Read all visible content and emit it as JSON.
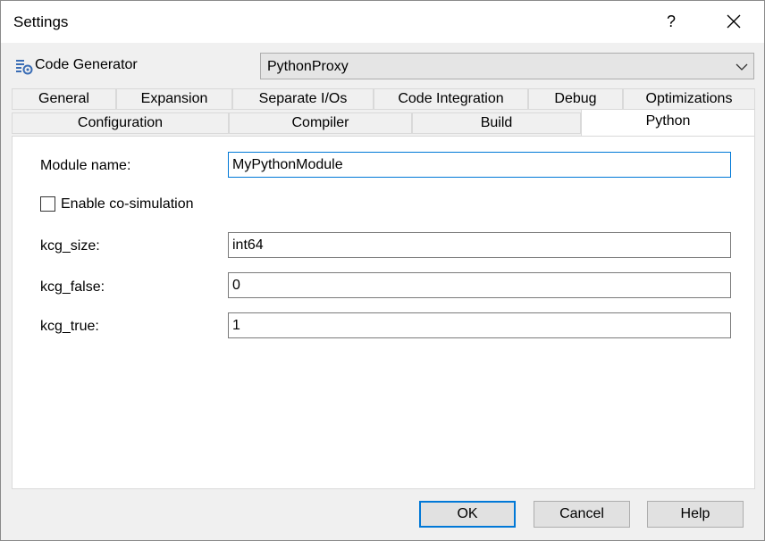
{
  "window": {
    "title": "Settings",
    "help_label": "?"
  },
  "codegen": {
    "label": "Code Generator",
    "selected": "PythonProxy"
  },
  "tabs_row1": [
    "General",
    "Expansion",
    "Separate I/Os",
    "Code Integration",
    "Debug",
    "Optimizations"
  ],
  "tabs_row2": [
    "Configuration",
    "Compiler",
    "Build",
    "Python"
  ],
  "active_tab": "Python",
  "form": {
    "module_name_label": "Module name:",
    "module_name_value": "MyPythonModule",
    "cosim_label": "Enable co-simulation",
    "cosim_checked": false,
    "kcg_size_label": "kcg_size:",
    "kcg_size_value": "int64",
    "kcg_false_label": "kcg_false:",
    "kcg_false_value": "0",
    "kcg_true_label": "kcg_true:",
    "kcg_true_value": "1"
  },
  "buttons": {
    "ok": "OK",
    "cancel": "Cancel",
    "help": "Help"
  },
  "colors": {
    "accent": "#0078d7",
    "panel": "#ffffff",
    "background": "#f0f0f0"
  }
}
